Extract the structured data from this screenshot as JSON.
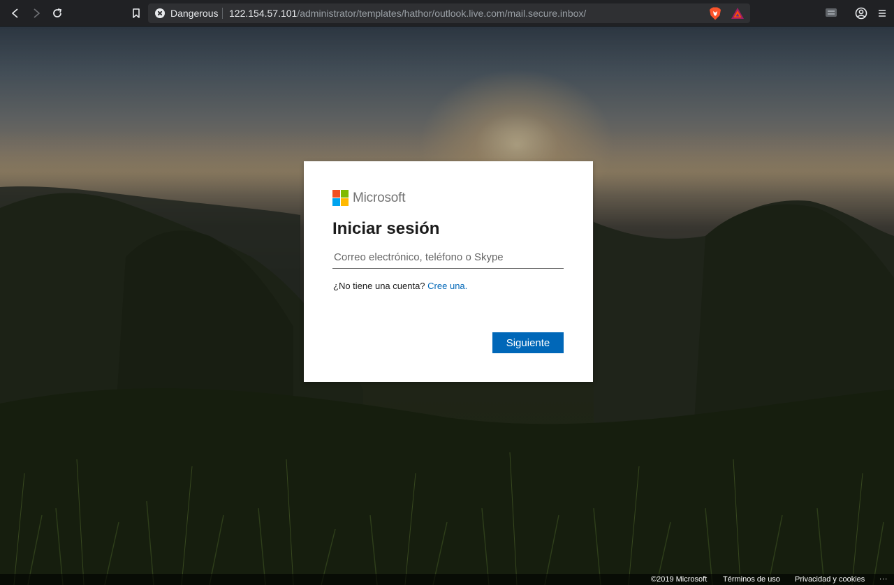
{
  "browser": {
    "security_label": "Dangerous",
    "url_host": "122.154.57.101",
    "url_path": "/administrator/templates/hathor/outlook.live.com/mail.secure.inbox/",
    "icons": [
      "back-icon",
      "forward-icon",
      "reload-icon",
      "bookmark-icon",
      "danger-icon",
      "brave-shield-icon",
      "bat-rewards-icon",
      "extension-icon",
      "profile-icon",
      "menu-icon"
    ]
  },
  "login": {
    "brand": "Microsoft",
    "brand_colors": [
      "#f25022",
      "#7fba00",
      "#00a4ef",
      "#ffb900"
    ],
    "title": "Iniciar sesión",
    "email_placeholder": "Correo electrónico, teléfono o Skype",
    "email_value": "",
    "no_account_text": "¿No tiene una cuenta?",
    "create_link": "Cree una.",
    "next_button": "Siguiente",
    "accent_color": "#0067b8"
  },
  "footer": {
    "copyright": "©2019 Microsoft",
    "terms": "Términos de uso",
    "privacy": "Privacidad y cookies",
    "more": "..."
  }
}
